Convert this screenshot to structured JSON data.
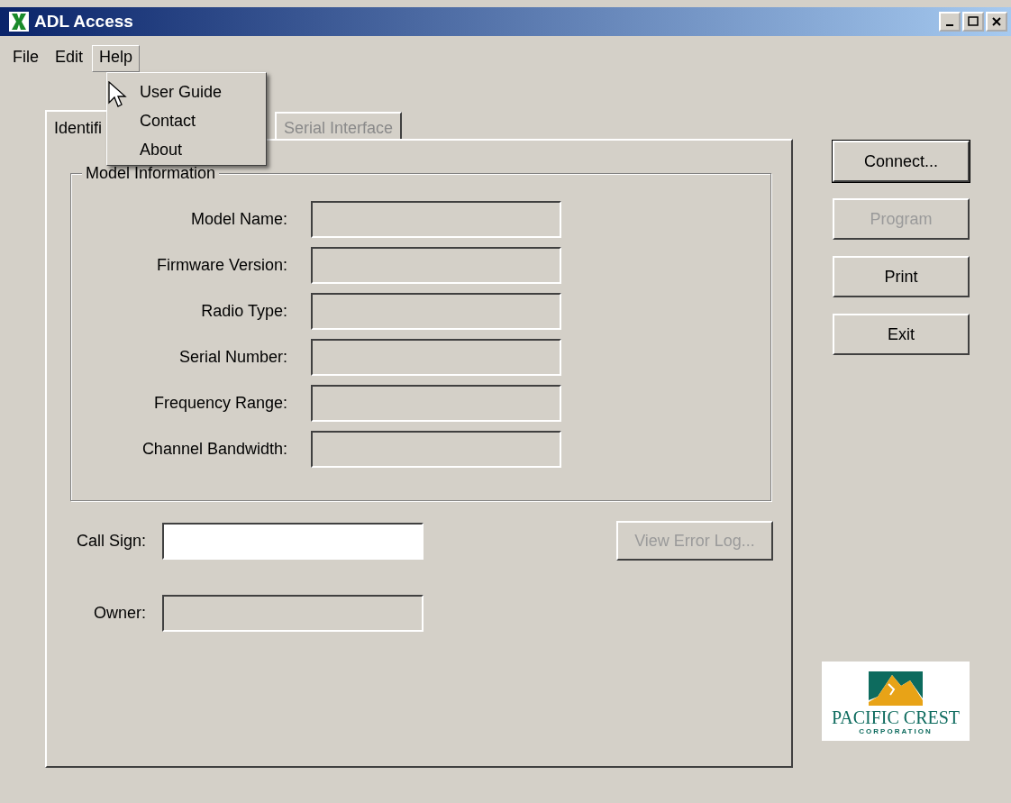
{
  "window": {
    "title": "ADL Access"
  },
  "menu_bar": [
    {
      "label": "File",
      "selected": false
    },
    {
      "label": "Edit",
      "selected": false
    },
    {
      "label": "Help",
      "selected": true
    }
  ],
  "open_menu": {
    "items": [
      "User Guide",
      "Contact",
      "About"
    ]
  },
  "tabs": [
    {
      "label": "Identifi",
      "selected": true,
      "disabled": false
    },
    {
      "label": "Serial Interface",
      "selected": false,
      "disabled": true
    }
  ],
  "group": {
    "title": "Model Information",
    "fields": [
      {
        "label": "Model Name:",
        "disabled": true
      },
      {
        "label": "Firmware Version:",
        "disabled": true
      },
      {
        "label": "Radio Type:",
        "disabled": true
      },
      {
        "label": "Serial Number:",
        "disabled": true
      },
      {
        "label": "Frequency Range:",
        "disabled": true
      },
      {
        "label": "Channel Bandwidth:",
        "disabled": true
      }
    ]
  },
  "call_sign": {
    "label": "Call Sign:",
    "disabled": false
  },
  "owner": {
    "label": "Owner:",
    "disabled": true
  },
  "error_log_button": {
    "label": "View Error Log...",
    "disabled": true
  },
  "buttons": [
    {
      "label": "Connect...",
      "disabled": false,
      "default": true
    },
    {
      "label": "Program",
      "disabled": true,
      "default": false
    },
    {
      "label": "Print",
      "disabled": false,
      "default": false
    },
    {
      "label": "Exit",
      "disabled": false,
      "default": false
    }
  ],
  "logo": {
    "name": "PACIFIC CREST",
    "subtitle": "CORPORATION"
  }
}
